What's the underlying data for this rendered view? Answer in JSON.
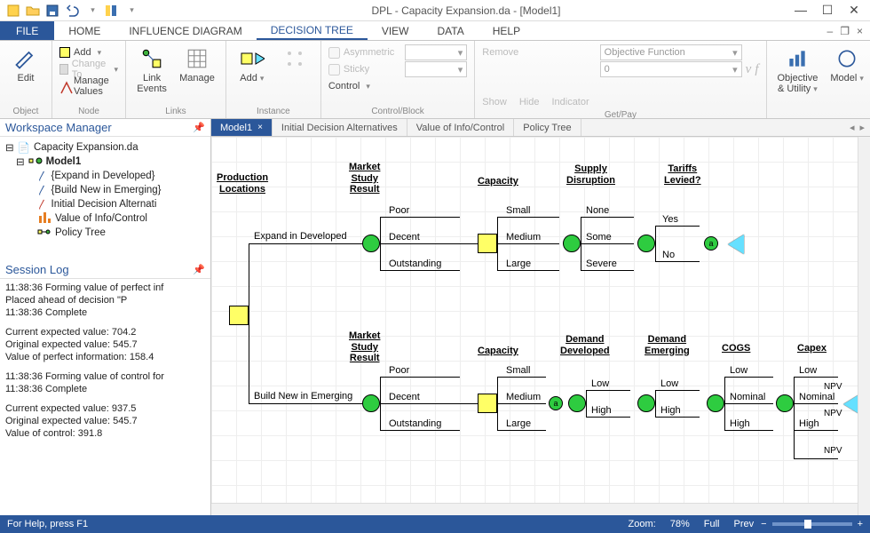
{
  "title": "DPL - Capacity Expansion.da - [Model1]",
  "ribbonTabs": {
    "file": "FILE",
    "home": "HOME",
    "influence": "INFLUENCE DIAGRAM",
    "decision": "DECISION TREE",
    "view": "VIEW",
    "data": "DATA",
    "help": "HELP"
  },
  "ribbon": {
    "object": {
      "edit": "Edit",
      "label": "Object"
    },
    "node": {
      "add": "Add",
      "changeTo": "Change To",
      "manageValues": "Manage Values",
      "label": "Node"
    },
    "links": {
      "linkEvents": "Link\nEvents",
      "manage": "Manage",
      "label": "Links"
    },
    "instance": {
      "add": "Add",
      "label": "Instance"
    },
    "controlBlock": {
      "asymmetric": "Asymmetric",
      "sticky": "Sticky",
      "control": "Control",
      "label": "Control/Block"
    },
    "getPay": {
      "remove": "Remove",
      "objective": "Objective Function",
      "zero": "0",
      "show": "Show",
      "hide": "Hide",
      "indicator": "Indicator",
      "v": "v",
      "f": "f",
      "label": "Get/Pay"
    },
    "right": {
      "objUtil": "Objective\n& Utility",
      "model": "Model"
    }
  },
  "workspace": {
    "title": "Workspace Manager",
    "root": "Capacity Expansion.da",
    "model": "Model1",
    "items": [
      "{Expand in Developed}",
      "{Build New in Emerging}",
      "Initial Decision Alternati",
      "Value of Info/Control",
      "Policy Tree"
    ]
  },
  "sessionLog": {
    "title": "Session Log",
    "lines": [
      "11:38:36  Forming value of perfect inf",
      "              Placed ahead of decision \"P",
      "11:38:36  Complete",
      "",
      "Current expected value: 704.2",
      "Original expected value: 545.7",
      "Value of perfect information: 158.4",
      "",
      "11:38:36  Forming value of control for",
      "11:38:36  Complete",
      "",
      "Current expected value: 937.5",
      "Original expected value: 545.7",
      "Value of control: 391.8"
    ]
  },
  "docTabs": [
    "Model1",
    "Initial Decision Alternatives",
    "Value of Info/Control",
    "Policy Tree"
  ],
  "tree": {
    "headers": {
      "prodLoc": "Production\nLocations",
      "marketStudy": "Market\nStudy\nResult",
      "capacity": "Capacity",
      "supplyDisruption": "Supply\nDisruption",
      "tariffs": "Tariffs\nLevied?",
      "demandDev": "Demand\nDeveloped",
      "demandEm": "Demand\nEmerging",
      "cogs": "COGS",
      "capex": "Capex"
    },
    "branches": {
      "expand": "Expand in Developed",
      "build": "Build New in Emerging",
      "poor": "Poor",
      "decent": "Decent",
      "outstanding": "Outstanding",
      "small": "Small",
      "medium": "Medium",
      "large": "Large",
      "none": "None",
      "some": "Some",
      "severe": "Severe",
      "yes": "Yes",
      "no": "No",
      "low": "Low",
      "high": "High",
      "nominal": "Nominal",
      "npv": "NPV",
      "a": "a"
    }
  },
  "status": {
    "help": "For Help, press F1",
    "zoom": "Zoom:",
    "zoomVal": "78%",
    "full": "Full",
    "prev": "Prev"
  }
}
